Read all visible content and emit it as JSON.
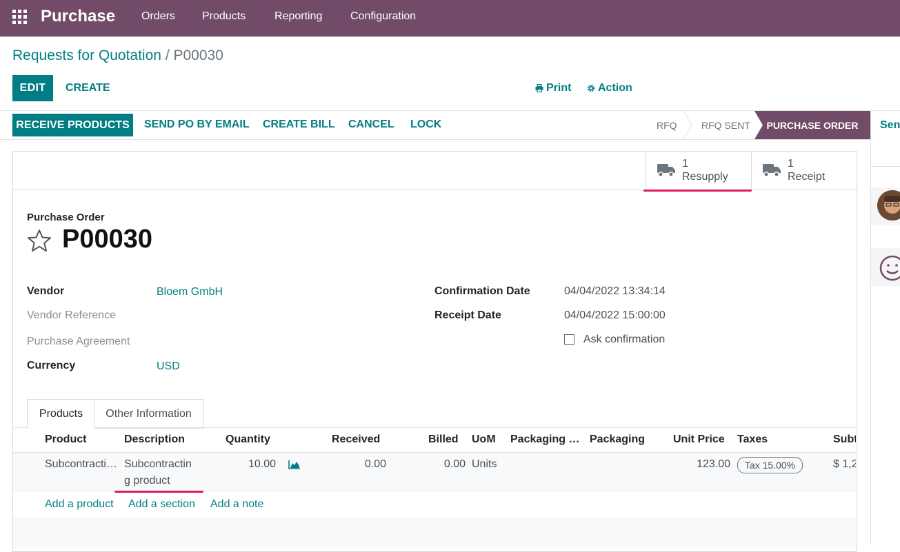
{
  "navbar": {
    "app_name": "Purchase",
    "menu": [
      "Orders",
      "Products",
      "Reporting",
      "Configuration"
    ]
  },
  "breadcrumb": {
    "parent": "Requests for Quotation",
    "separator": "/",
    "current": "P00030"
  },
  "control": {
    "edit_label": "EDIT",
    "create_label": "CREATE",
    "print_label": "Print",
    "action_label": "Action"
  },
  "statusbar": {
    "buttons": [
      "RECEIVE PRODUCTS",
      "SEND PO BY EMAIL",
      "CREATE BILL",
      "CANCEL",
      "LOCK"
    ],
    "stages": [
      "RFQ",
      "RFQ SENT",
      "PURCHASE ORDER"
    ],
    "active_stage": "PURCHASE ORDER"
  },
  "smart_buttons": [
    {
      "count": "1",
      "label": "Resupply"
    },
    {
      "count": "1",
      "label": "Receipt"
    }
  ],
  "form": {
    "type_label": "Purchase Order",
    "name": "P00030",
    "vendor_label": "Vendor",
    "vendor": "Bloem GmbH",
    "vendor_ref_label": "Vendor Reference",
    "agreement_label": "Purchase Agreement",
    "currency_label": "Currency",
    "currency": "USD",
    "confirmation_date_label": "Confirmation Date",
    "confirmation_date": "04/04/2022 13:34:14",
    "receipt_date_label": "Receipt Date",
    "receipt_date": "04/04/2022 15:00:00",
    "ask_confirmation_label": "Ask confirmation"
  },
  "tabs": [
    "Products",
    "Other Information"
  ],
  "lines_table": {
    "headers": [
      "Product",
      "Description",
      "Quantity",
      "Received",
      "Billed",
      "UoM",
      "Packaging …",
      "Packaging",
      "Unit Price",
      "Taxes",
      "Subt"
    ],
    "row": {
      "product": "Subcontracti…",
      "description_1": "Subcontractin",
      "description_2": "g product",
      "quantity": "10.00",
      "received": "0.00",
      "billed": "0.00",
      "uom": "Units",
      "unit_price": "123.00",
      "tax": "Tax 15.00%",
      "subtotal": "$ 1,2"
    },
    "add_links": [
      "Add a product",
      "Add a section",
      "Add a note"
    ]
  },
  "chatter": {
    "send_label": "Send"
  },
  "colors": {
    "brand": "#714B67",
    "primary": "#017e84",
    "highlight": "#e2185f"
  }
}
